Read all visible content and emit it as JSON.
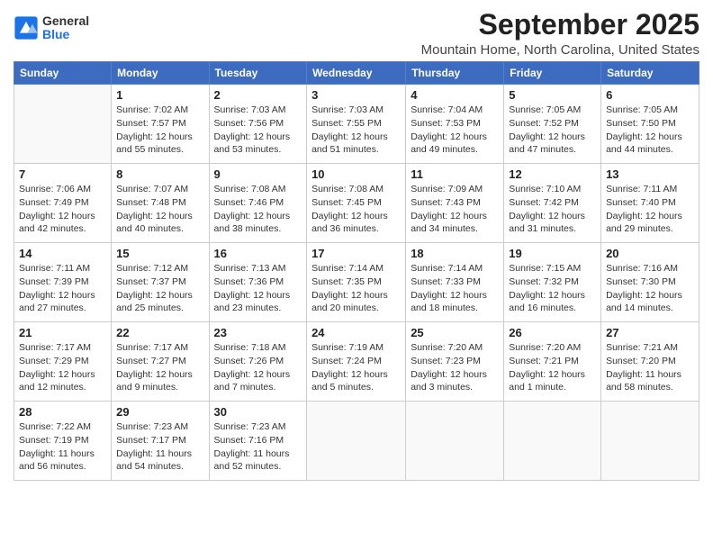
{
  "header": {
    "logo_general": "General",
    "logo_blue": "Blue",
    "month": "September 2025",
    "location": "Mountain Home, North Carolina, United States"
  },
  "weekdays": [
    "Sunday",
    "Monday",
    "Tuesday",
    "Wednesday",
    "Thursday",
    "Friday",
    "Saturday"
  ],
  "weeks": [
    [
      {
        "day": "",
        "info": ""
      },
      {
        "day": "1",
        "info": "Sunrise: 7:02 AM\nSunset: 7:57 PM\nDaylight: 12 hours\nand 55 minutes."
      },
      {
        "day": "2",
        "info": "Sunrise: 7:03 AM\nSunset: 7:56 PM\nDaylight: 12 hours\nand 53 minutes."
      },
      {
        "day": "3",
        "info": "Sunrise: 7:03 AM\nSunset: 7:55 PM\nDaylight: 12 hours\nand 51 minutes."
      },
      {
        "day": "4",
        "info": "Sunrise: 7:04 AM\nSunset: 7:53 PM\nDaylight: 12 hours\nand 49 minutes."
      },
      {
        "day": "5",
        "info": "Sunrise: 7:05 AM\nSunset: 7:52 PM\nDaylight: 12 hours\nand 47 minutes."
      },
      {
        "day": "6",
        "info": "Sunrise: 7:05 AM\nSunset: 7:50 PM\nDaylight: 12 hours\nand 44 minutes."
      }
    ],
    [
      {
        "day": "7",
        "info": "Sunrise: 7:06 AM\nSunset: 7:49 PM\nDaylight: 12 hours\nand 42 minutes."
      },
      {
        "day": "8",
        "info": "Sunrise: 7:07 AM\nSunset: 7:48 PM\nDaylight: 12 hours\nand 40 minutes."
      },
      {
        "day": "9",
        "info": "Sunrise: 7:08 AM\nSunset: 7:46 PM\nDaylight: 12 hours\nand 38 minutes."
      },
      {
        "day": "10",
        "info": "Sunrise: 7:08 AM\nSunset: 7:45 PM\nDaylight: 12 hours\nand 36 minutes."
      },
      {
        "day": "11",
        "info": "Sunrise: 7:09 AM\nSunset: 7:43 PM\nDaylight: 12 hours\nand 34 minutes."
      },
      {
        "day": "12",
        "info": "Sunrise: 7:10 AM\nSunset: 7:42 PM\nDaylight: 12 hours\nand 31 minutes."
      },
      {
        "day": "13",
        "info": "Sunrise: 7:11 AM\nSunset: 7:40 PM\nDaylight: 12 hours\nand 29 minutes."
      }
    ],
    [
      {
        "day": "14",
        "info": "Sunrise: 7:11 AM\nSunset: 7:39 PM\nDaylight: 12 hours\nand 27 minutes."
      },
      {
        "day": "15",
        "info": "Sunrise: 7:12 AM\nSunset: 7:37 PM\nDaylight: 12 hours\nand 25 minutes."
      },
      {
        "day": "16",
        "info": "Sunrise: 7:13 AM\nSunset: 7:36 PM\nDaylight: 12 hours\nand 23 minutes."
      },
      {
        "day": "17",
        "info": "Sunrise: 7:14 AM\nSunset: 7:35 PM\nDaylight: 12 hours\nand 20 minutes."
      },
      {
        "day": "18",
        "info": "Sunrise: 7:14 AM\nSunset: 7:33 PM\nDaylight: 12 hours\nand 18 minutes."
      },
      {
        "day": "19",
        "info": "Sunrise: 7:15 AM\nSunset: 7:32 PM\nDaylight: 12 hours\nand 16 minutes."
      },
      {
        "day": "20",
        "info": "Sunrise: 7:16 AM\nSunset: 7:30 PM\nDaylight: 12 hours\nand 14 minutes."
      }
    ],
    [
      {
        "day": "21",
        "info": "Sunrise: 7:17 AM\nSunset: 7:29 PM\nDaylight: 12 hours\nand 12 minutes."
      },
      {
        "day": "22",
        "info": "Sunrise: 7:17 AM\nSunset: 7:27 PM\nDaylight: 12 hours\nand 9 minutes."
      },
      {
        "day": "23",
        "info": "Sunrise: 7:18 AM\nSunset: 7:26 PM\nDaylight: 12 hours\nand 7 minutes."
      },
      {
        "day": "24",
        "info": "Sunrise: 7:19 AM\nSunset: 7:24 PM\nDaylight: 12 hours\nand 5 minutes."
      },
      {
        "day": "25",
        "info": "Sunrise: 7:20 AM\nSunset: 7:23 PM\nDaylight: 12 hours\nand 3 minutes."
      },
      {
        "day": "26",
        "info": "Sunrise: 7:20 AM\nSunset: 7:21 PM\nDaylight: 12 hours\nand 1 minute."
      },
      {
        "day": "27",
        "info": "Sunrise: 7:21 AM\nSunset: 7:20 PM\nDaylight: 11 hours\nand 58 minutes."
      }
    ],
    [
      {
        "day": "28",
        "info": "Sunrise: 7:22 AM\nSunset: 7:19 PM\nDaylight: 11 hours\nand 56 minutes."
      },
      {
        "day": "29",
        "info": "Sunrise: 7:23 AM\nSunset: 7:17 PM\nDaylight: 11 hours\nand 54 minutes."
      },
      {
        "day": "30",
        "info": "Sunrise: 7:23 AM\nSunset: 7:16 PM\nDaylight: 11 hours\nand 52 minutes."
      },
      {
        "day": "",
        "info": ""
      },
      {
        "day": "",
        "info": ""
      },
      {
        "day": "",
        "info": ""
      },
      {
        "day": "",
        "info": ""
      }
    ]
  ]
}
